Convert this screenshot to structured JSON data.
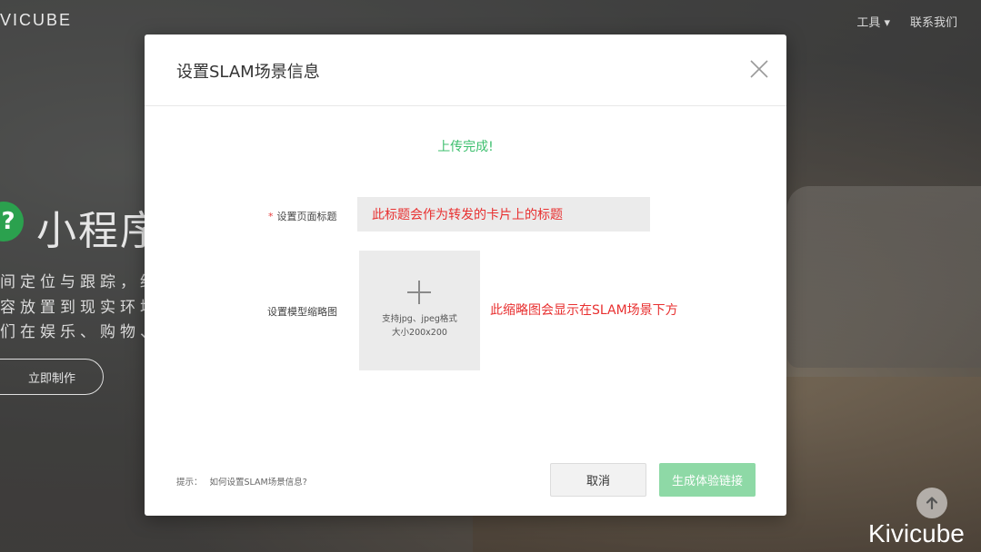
{
  "background": {
    "brand": "VICUBE",
    "nav": [
      "工具 ▾",
      "联系我们"
    ],
    "hero_logo_glyph": "?",
    "hero_title": "小程序",
    "hero_lines": [
      "间定位与跟踪，结",
      "容放置到现实环境",
      "们在娱乐、购物、"
    ],
    "hero_button": "立即制作",
    "watermark": "Kivicube"
  },
  "modal": {
    "title": "设置SLAM场景信息",
    "success_message": "上传完成!",
    "page_title_field": {
      "required_mark": "*",
      "label": "设置页面标题",
      "value": "此标题会作为转发的卡片上的标题"
    },
    "thumbnail_field": {
      "label": "设置模型缩略图",
      "hint_line1": "支持jpg、jpeg格式",
      "hint_line2": "大小200x200",
      "note": "此缩略图会显示在SLAM场景下方"
    },
    "tip_prefix": "提示：",
    "tip_link": "如何设置SLAM场景信息?",
    "cancel_label": "取消",
    "generate_label": "生成体验链接"
  },
  "colors": {
    "success": "#3cbf6d",
    "annotation_red": "#e83030",
    "generate_button": "#8ed9a6",
    "hero_logo": "#2ba14e"
  },
  "icons": [
    "close-icon",
    "plus-icon",
    "arrow-up-icon"
  ]
}
